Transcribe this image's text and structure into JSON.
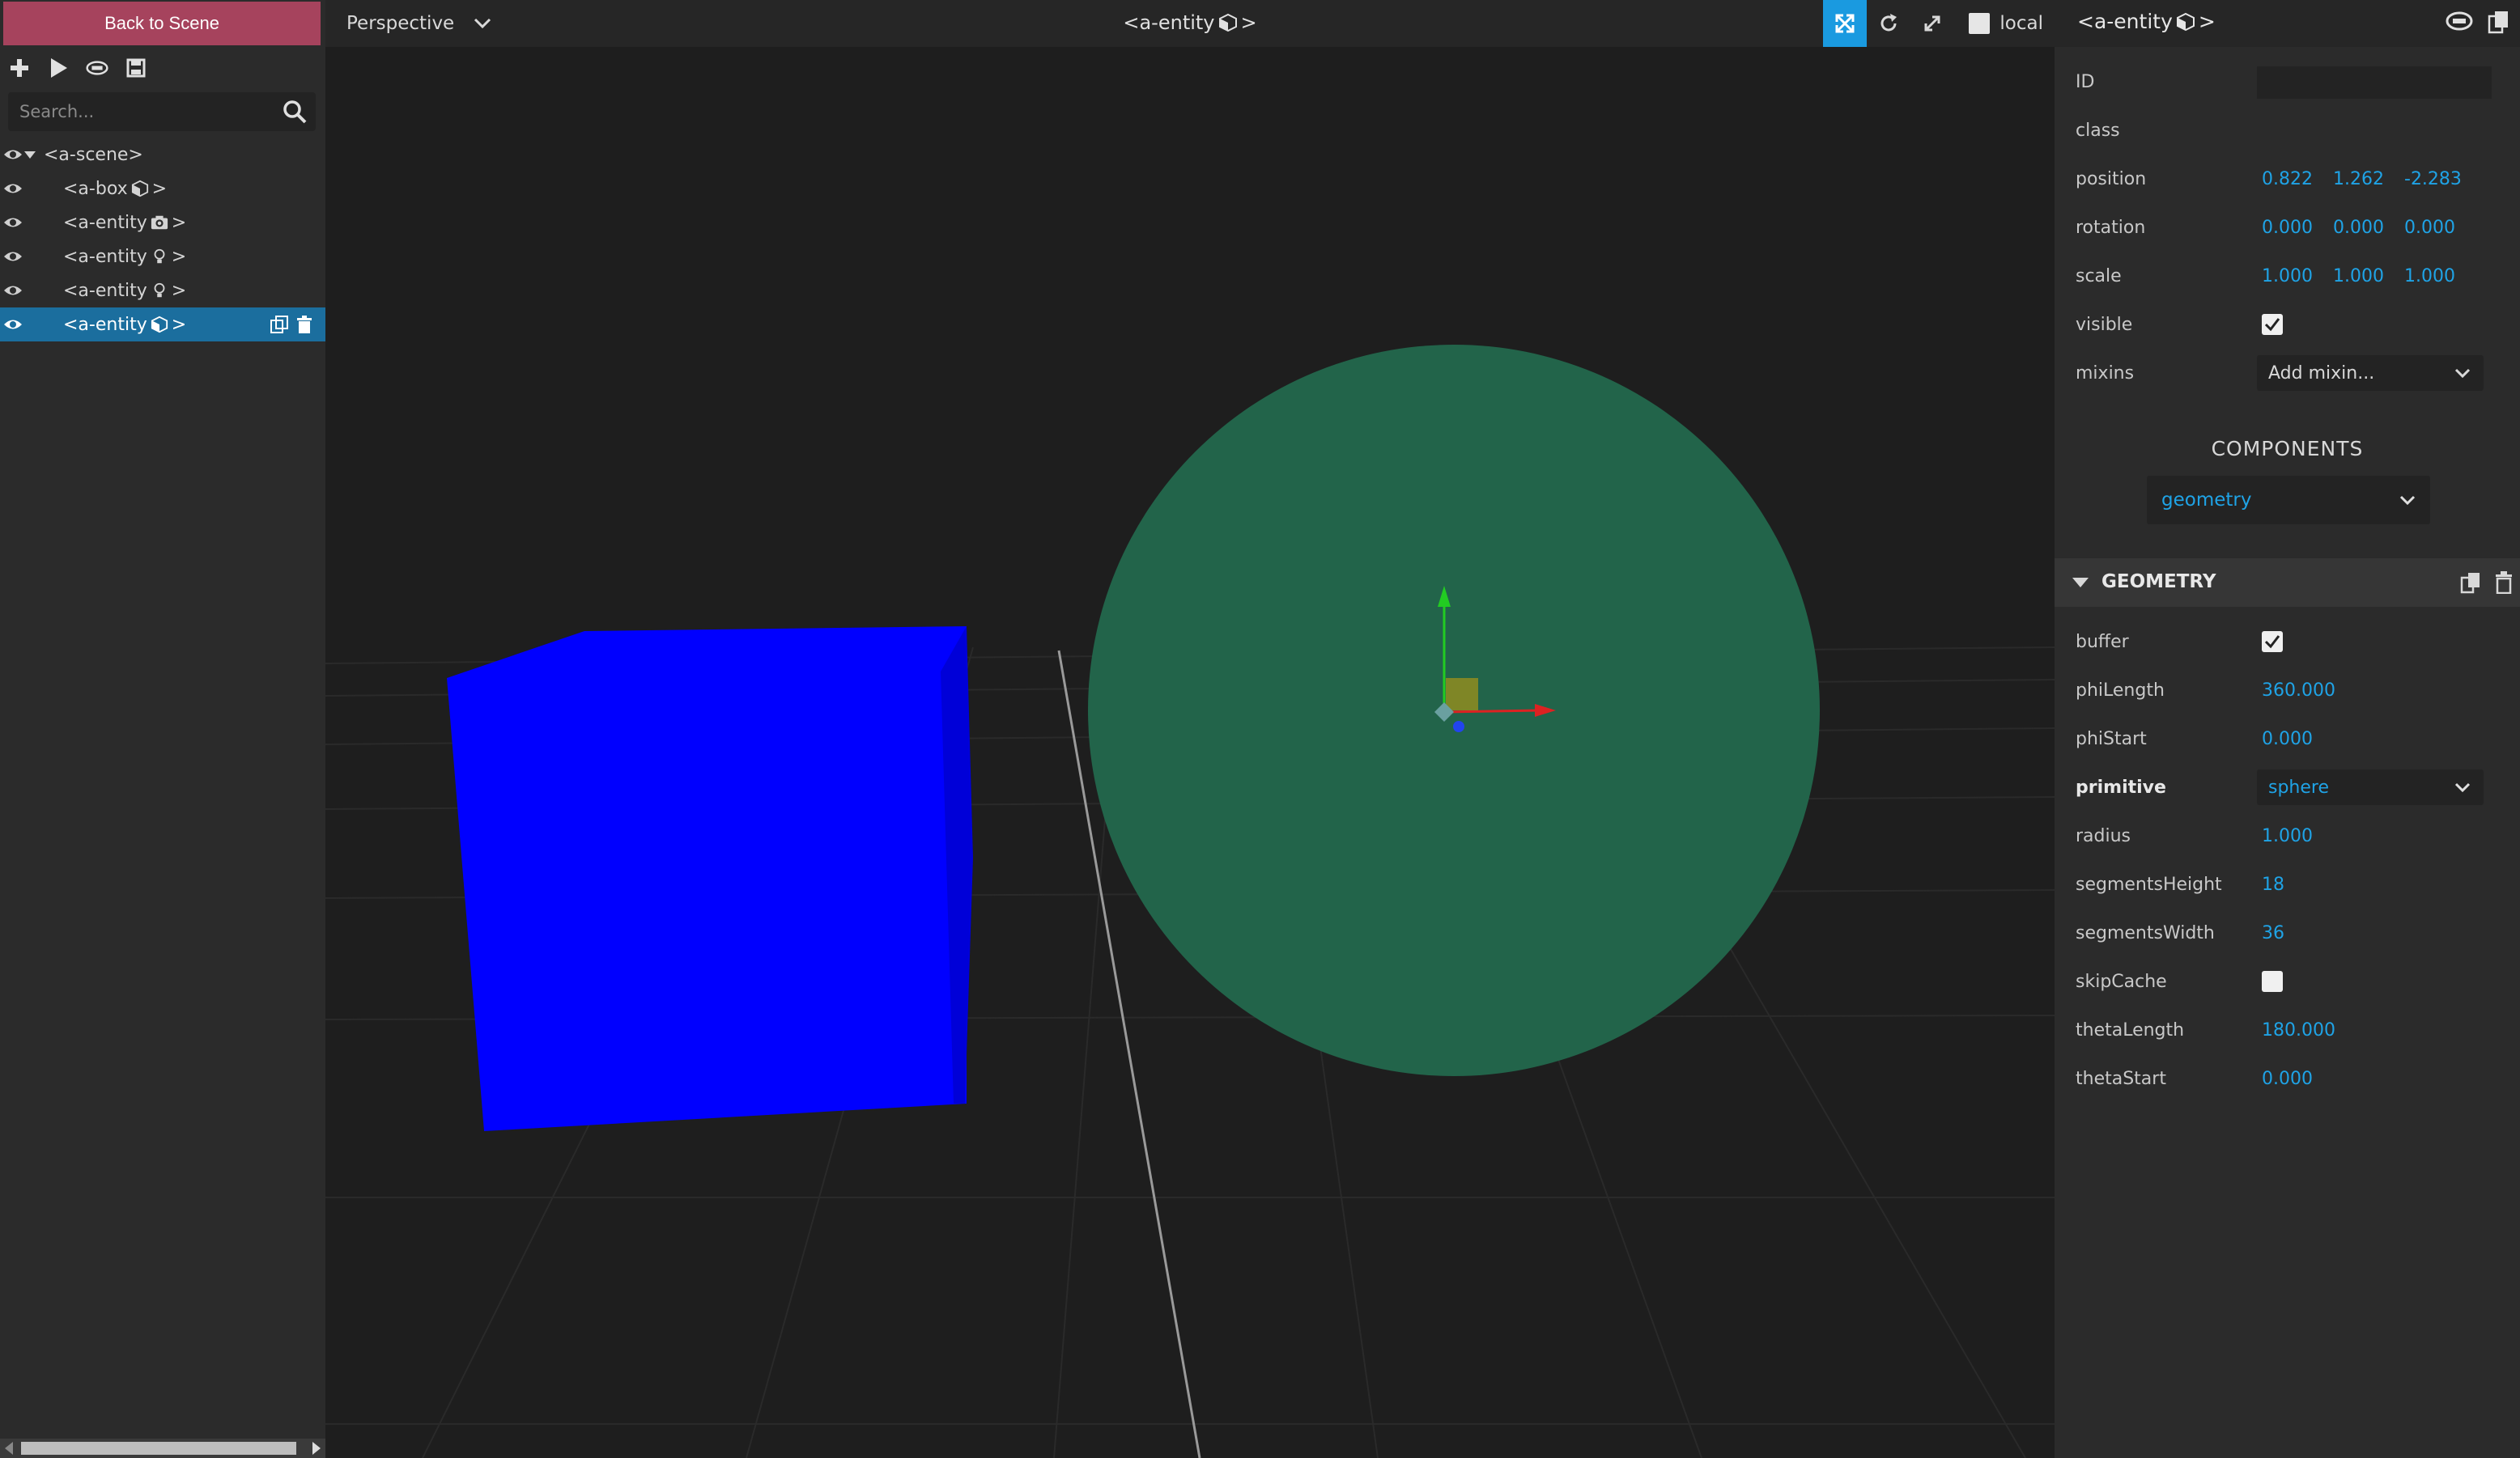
{
  "left_panel": {
    "back_label": "Back to Scene",
    "search_placeholder": "Search...",
    "tree": [
      {
        "label": "<a-scene>",
        "icon": "",
        "selected": false
      },
      {
        "label": "<a-box",
        "icon": "cube-icon",
        "selected": false
      },
      {
        "label": "<a-entity",
        "icon": "camera-icon",
        "selected": false
      },
      {
        "label": "<a-entity",
        "icon": "light-icon",
        "selected": false
      },
      {
        "label": "<a-entity",
        "icon": "light-icon",
        "selected": false
      },
      {
        "label": "<a-entity",
        "icon": "cube-icon",
        "selected": true
      }
    ],
    "close_tag": ">"
  },
  "viewport": {
    "camera": "Perspective",
    "title": "<a-entity",
    "title_suffix": ">",
    "local_label": "local"
  },
  "colors": {
    "back_button": "#a6435d",
    "selected_row": "#1b6e9e",
    "accent_blue": "#1fa3e6",
    "box": "#0000ff",
    "sphere": "#22644a"
  },
  "inspector": {
    "title": "<a-entity",
    "title_suffix": ">",
    "id_label": "ID",
    "id_value": "",
    "class_label": "class",
    "position_label": "position",
    "position": [
      "0.822",
      "1.262",
      "-2.283"
    ],
    "rotation_label": "rotation",
    "rotation": [
      "0.000",
      "0.000",
      "0.000"
    ],
    "scale_label": "scale",
    "scale": [
      "1.000",
      "1.000",
      "1.000"
    ],
    "visible_label": "visible",
    "visible": true,
    "mixins_label": "mixins",
    "mixins_value": "Add mixin...",
    "components_heading": "COMPONENTS",
    "component_select": "geometry",
    "geometry_title": "GEOMETRY",
    "geometry": {
      "buffer_label": "buffer",
      "buffer": true,
      "philength_label": "phiLength",
      "philength": "360.000",
      "phistart_label": "phiStart",
      "phistart": "0.000",
      "primitive_label": "primitive",
      "primitive": "sphere",
      "radius_label": "radius",
      "radius": "1.000",
      "segheight_label": "segmentsHeight",
      "segheight": "18",
      "segwidth_label": "segmentsWidth",
      "segwidth": "36",
      "skipcache_label": "skipCache",
      "skipcache": false,
      "thetalength_label": "thetaLength",
      "thetalength": "180.000",
      "thetastart_label": "thetaStart",
      "thetastart": "0.000"
    }
  }
}
